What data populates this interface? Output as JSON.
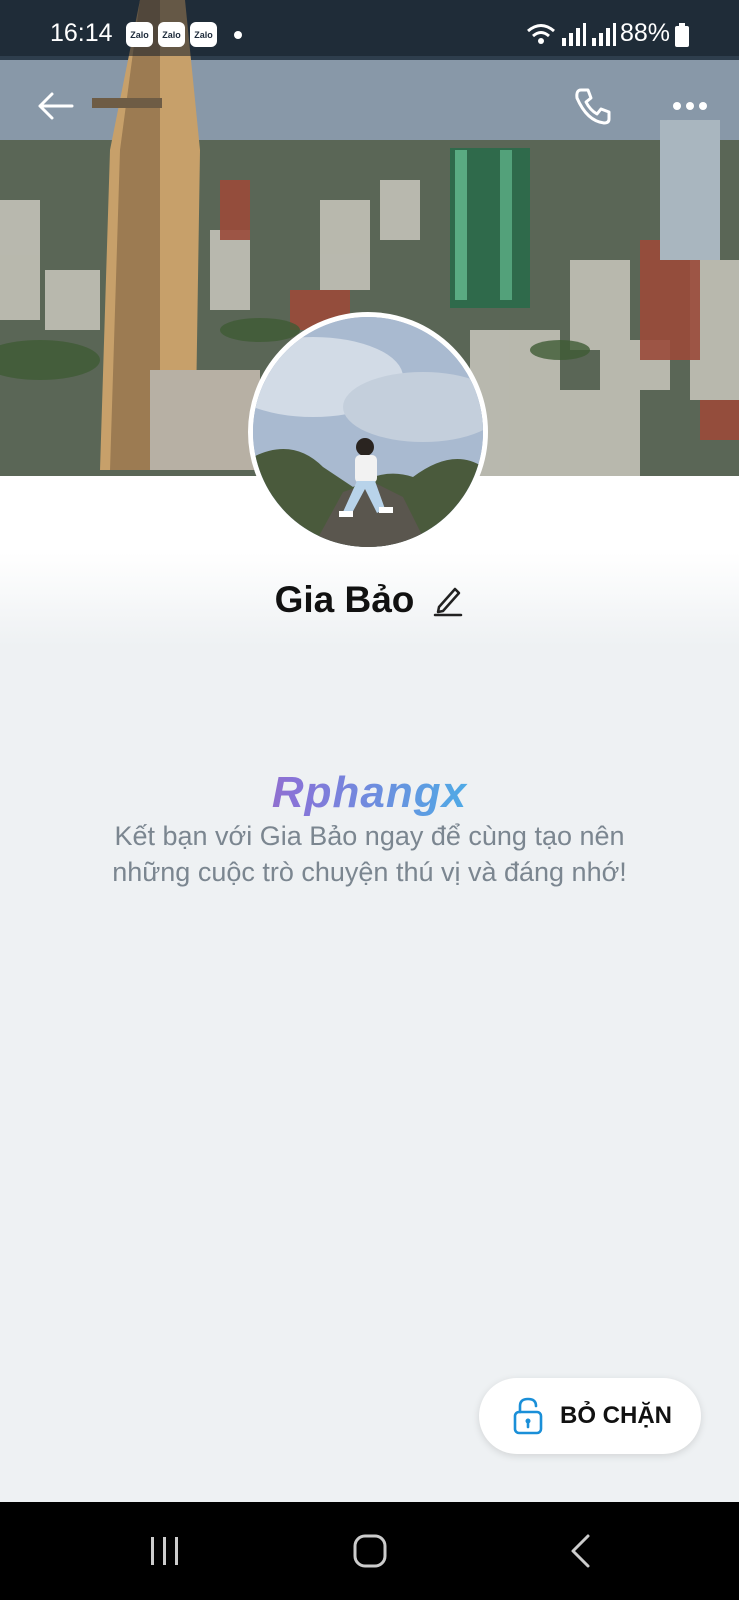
{
  "status_bar": {
    "time": "16:14",
    "notification_apps": [
      "Zalo",
      "Zalo",
      "Zalo"
    ],
    "battery": "88%",
    "icons": [
      "wifi-icon",
      "signal-icon",
      "signal-icon",
      "battery-icon"
    ]
  },
  "profile": {
    "name": "Gia Bảo"
  },
  "watermark": "Rphangx",
  "message": "Kết bạn với Gia Bảo ngay để cùng tạo nên những cuộc trò chuyện thú vị và đáng nhớ!",
  "unblock_button": {
    "label": "BỎ CHẶN"
  },
  "colors": {
    "accent": "#1a8fd8",
    "background": "#eef1f3",
    "text_muted": "#7b8690"
  }
}
